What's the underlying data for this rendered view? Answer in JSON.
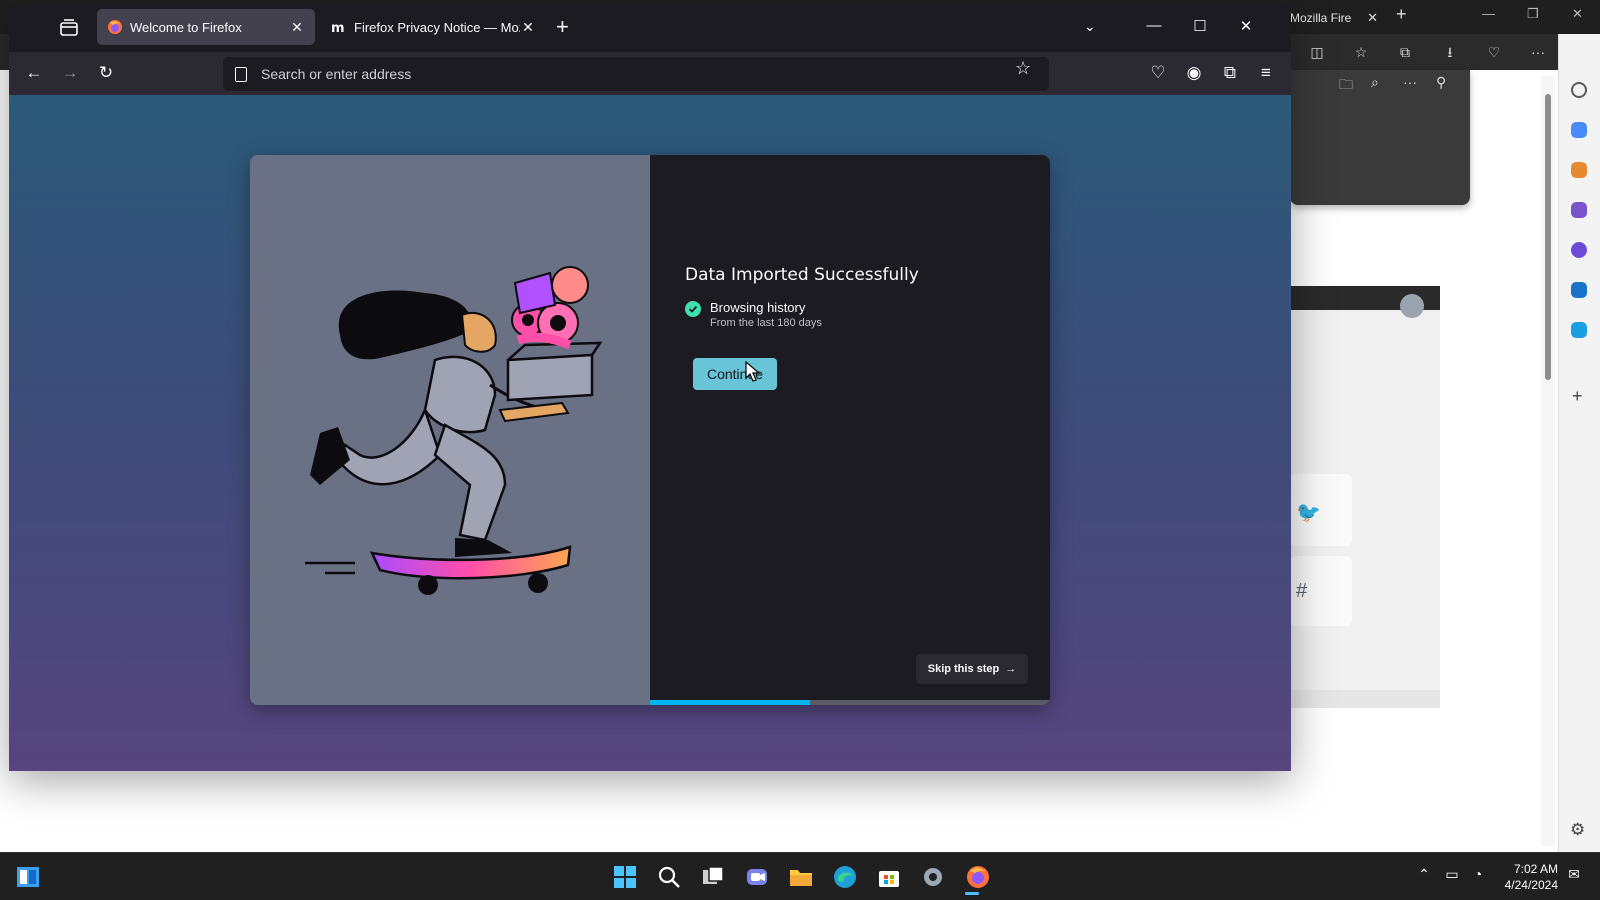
{
  "firefox": {
    "tabs": [
      {
        "title": "Welcome to Firefox",
        "active": true
      },
      {
        "title": "Firefox Privacy Notice — Mozilla",
        "active": false
      }
    ],
    "url_placeholder": "Search or enter address",
    "onboarding": {
      "heading": "Data Imported Successfully",
      "items": [
        {
          "title": "Browsing history",
          "subtitle": "From the last 180 days",
          "status": "imported"
        }
      ],
      "continue_label": "Continue",
      "skip_label": "Skip this step",
      "progress_fraction": 0.4
    }
  },
  "edge": {
    "tab_title": "Mozilla Fire"
  },
  "taskbar": {
    "time": "7:02 AM",
    "date": "4/24/2024",
    "apps": [
      "start-icon",
      "search-icon",
      "task-view-icon",
      "teams-icon",
      "file-explorer-icon",
      "edge-icon",
      "store-icon",
      "settings-icon",
      "firefox-icon"
    ]
  },
  "colors": {
    "accent": "#68c4d6",
    "progress": "#00b3f4",
    "success": "#3fe1b0"
  }
}
